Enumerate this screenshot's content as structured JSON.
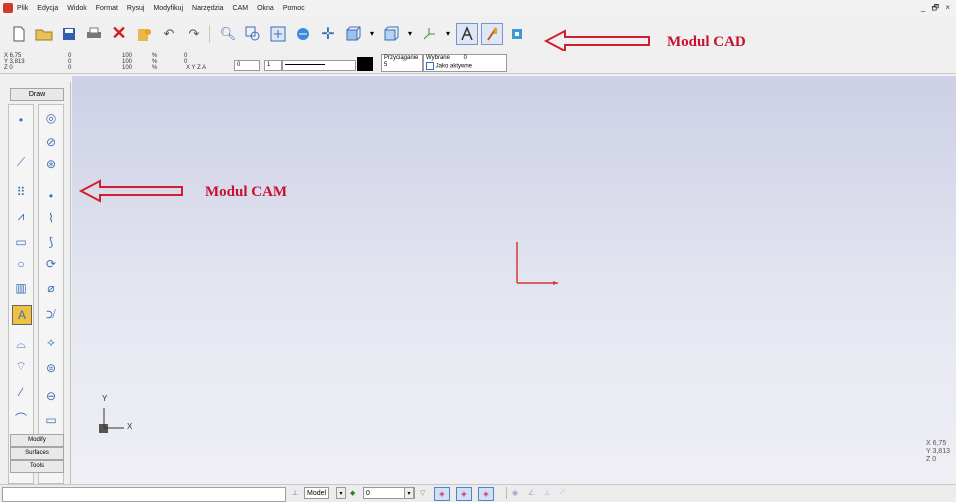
{
  "menu": [
    "Plik",
    "Edycja",
    "Widok",
    "Format",
    "Rysuj",
    "Modyfikuj",
    "Narzędzia",
    "CAM",
    "Okna",
    "Pomoc"
  ],
  "window_controls": "_ 🗗 ×",
  "annotations": {
    "cad": "Modul CAD",
    "cam": "Modul CAM"
  },
  "propbar": {
    "x": "X 6,75",
    "y": "Y 3,813",
    "z": "Z 0",
    "lw1": "0",
    "lw2": "0",
    "lw3": "0",
    "pct1": "100",
    "pct2": "100",
    "pct3": "100",
    "pct_sym": "%",
    "rot": "0",
    "rot2": "0",
    "xyz": "X Y Z A",
    "layer": "0",
    "linewidth": "1",
    "snap_label": "Przyciąganie",
    "snap_value": "5",
    "selected_label": "Wybrane",
    "selected_value": "0",
    "as_active": "Jako aktywne"
  },
  "left_panel": {
    "draw_tab": "Draw",
    "tabs": [
      "Modify",
      "Surfaces",
      "Tools"
    ]
  },
  "viewport": {
    "ucs_labels": {
      "y": "Y",
      "x": "X"
    },
    "coords": {
      "x": "X 6,75",
      "y": "Y 3,813",
      "z": "Z 0"
    }
  },
  "statusbar": {
    "model_dropdown": "Model",
    "layer_dropdown": "0"
  },
  "colors": {
    "annotation": "#c8102e",
    "viewport_top": "#cdd0e6",
    "axis_red": "#d43a3a"
  }
}
